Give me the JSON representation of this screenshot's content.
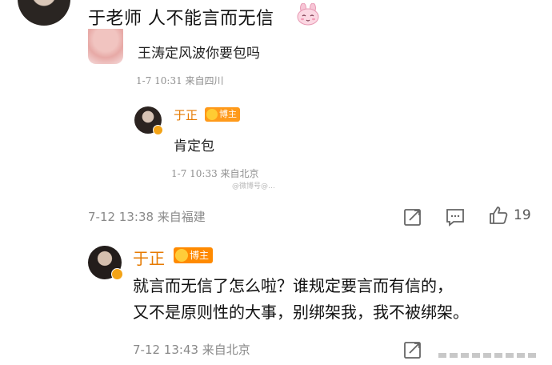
{
  "comment1": {
    "text": "于老师 人不能言而无信",
    "emoji": "bunny-emoji",
    "embedded_screenshot": {
      "question": "王涛定风波你要包吗",
      "question_meta": "1-7 10:31  来自四川",
      "reply_name": "于正",
      "reply_badge": "博主",
      "reply_text": "肯定包",
      "reply_meta": "1-7 10:33  来自北京",
      "watermark": "@微博号@…"
    },
    "meta": "7-12 13:38  来自福建",
    "like_count": "19"
  },
  "comment2": {
    "name": "于正",
    "badge": "博主",
    "line1": "就言而无信了怎么啦？谁规定要言而有信的，",
    "line2": "又不是原则性的大事，别绑架我，我不被绑架。",
    "meta": "7-12 13:43  来自北京"
  },
  "colors": {
    "accent_name": "#e67a00",
    "badge": "#ff8a00",
    "meta_gray": "#8a8a8a"
  }
}
